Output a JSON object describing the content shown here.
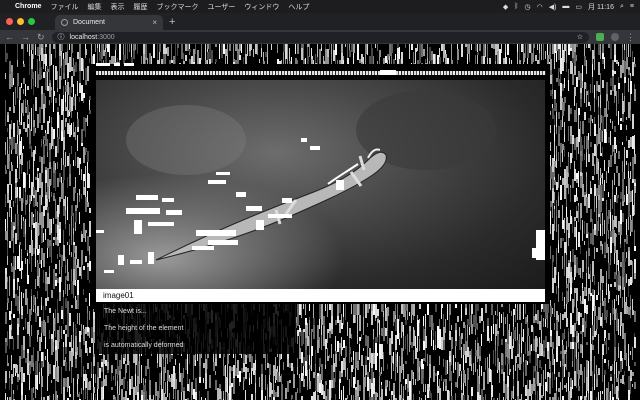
{
  "menubar": {
    "app": "Chrome",
    "items": [
      "ファイル",
      "編集",
      "表示",
      "履歴",
      "ブックマーク",
      "ユーザー",
      "ウィンドウ",
      "ヘルプ"
    ],
    "clock": "月 11:16"
  },
  "tab": {
    "title": "Document"
  },
  "toolbar": {
    "host": "localhost",
    "port": ":3000"
  },
  "colors": {
    "close": "#ff5f57",
    "minimize": "#febc2e",
    "zoom": "#28c840",
    "extension": "#4caf50"
  },
  "content": {
    "caption": "image01",
    "lines": [
      "The Newt is...",
      "The height of the element",
      "is automatically deformed"
    ]
  }
}
